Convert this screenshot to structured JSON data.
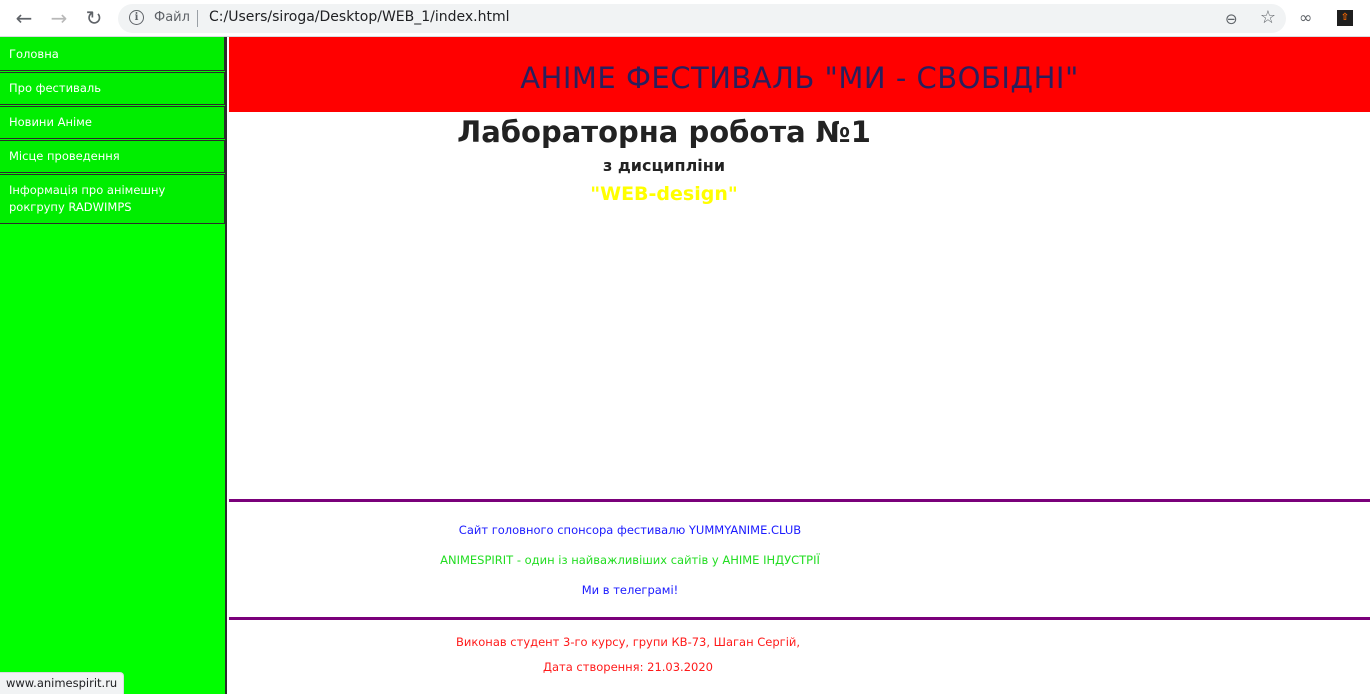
{
  "browser": {
    "scheme_label": "Файл",
    "url": "C:/Users/siroga/Desktop/WEB_1/index.html",
    "icons": [
      "back-arrow-icon",
      "forward-arrow-icon",
      "reload-icon",
      "info-icon",
      "zoom-out-icon",
      "star-icon",
      "infinity-extension-icon",
      "extension-icon"
    ]
  },
  "sidebar": {
    "items": [
      {
        "label": "Головна"
      },
      {
        "label": "Про фестиваль"
      },
      {
        "label": "Новини Аніме"
      },
      {
        "label": "Місце проведення"
      },
      {
        "label": "Інформація про анімешну рокгрупу RADWIMPS"
      }
    ],
    "colors": {
      "background": "#00ff00",
      "item": "#00ee00"
    }
  },
  "main": {
    "banner_title": "АНІМЕ ФЕСТИВАЛЬ \"МИ - СВОБІДНІ\"",
    "lab_title": "Лабораторна робота №1",
    "subtitle": "з дисципліни",
    "course": "\"WEB-design\"",
    "links": [
      "Сайт головного спонсора фестивалю YUMMYANIME.CLUB",
      "ANIMESPIRIT - один із найважливіших сайтів у АНІМЕ ІНДУСТРІЇ",
      "Ми в телеграмі!"
    ],
    "credits": [
      "Виконав студент 3-го курсу, групи КВ-73, Шаган Сергій,",
      "Дата створення: 21.03.2020"
    ],
    "colors": {
      "banner": "#ff0000",
      "course": "#ffff00",
      "divider": "#7a007a"
    }
  },
  "status_bar": {
    "text": "www.animespirit.ru"
  }
}
